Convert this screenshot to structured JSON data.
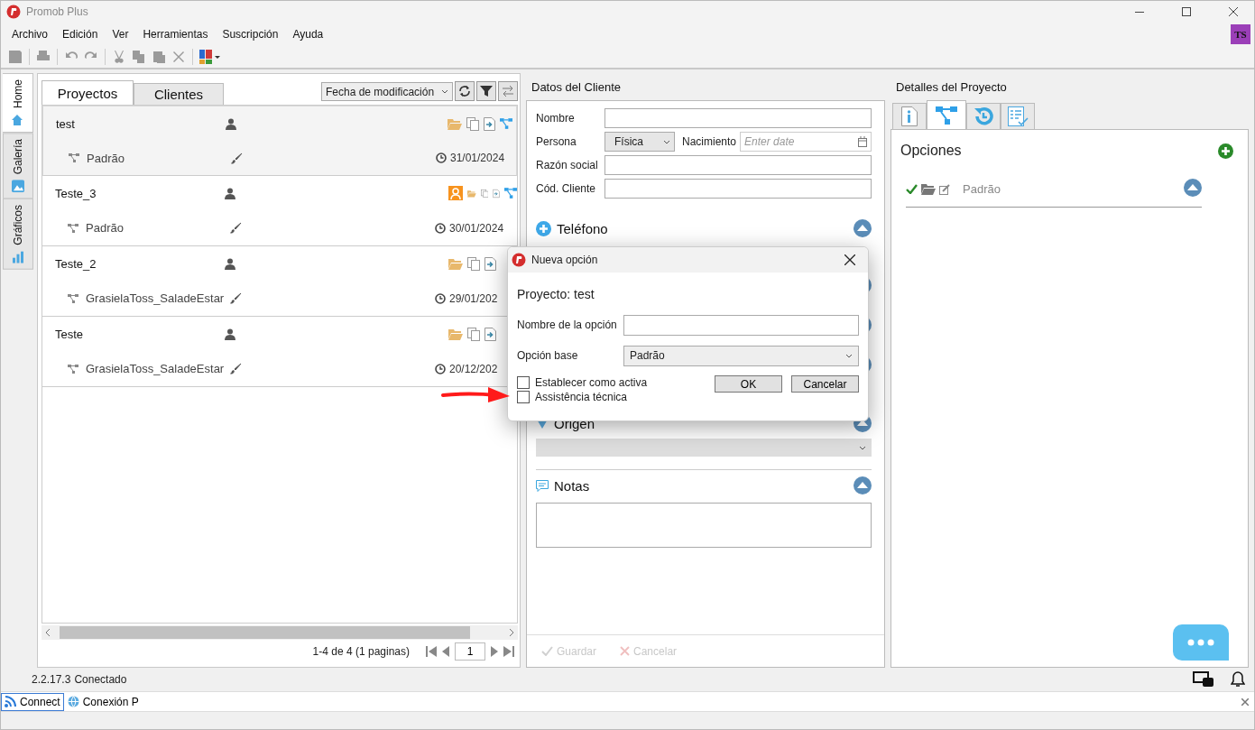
{
  "window": {
    "title": "Promob Plus"
  },
  "menu": [
    "Archivo",
    "Edición",
    "Ver",
    "Herramientas",
    "Suscripción",
    "Ayuda"
  ],
  "avatar": "TS",
  "side_tabs": [
    {
      "label": "Home",
      "selected": true,
      "kind": "home"
    },
    {
      "label": "Galería",
      "selected": false,
      "kind": "gallery"
    },
    {
      "label": "Gráficos",
      "selected": false,
      "kind": "charts"
    }
  ],
  "projects_panel": {
    "tabs": [
      {
        "label": "Proyectos",
        "selected": true
      },
      {
        "label": "Clientes",
        "selected": false
      }
    ],
    "sort": "Fecha de modificación",
    "projects": [
      {
        "name": "test",
        "selected": true,
        "shared": false,
        "branch_icon": true,
        "option": "Padrão",
        "date": "31/01/2024"
      },
      {
        "name": "Teste_3",
        "selected": false,
        "shared": true,
        "branch_icon": true,
        "option": "Padrão",
        "date": "30/01/2024"
      },
      {
        "name": "Teste_2",
        "selected": false,
        "shared": false,
        "branch_icon": false,
        "option": "GrasielaToss_SaladeEstar",
        "date": "29/01/202"
      },
      {
        "name": "Teste",
        "selected": false,
        "shared": false,
        "branch_icon": false,
        "option": "GrasielaToss_SaladeEstar",
        "date": "20/12/202"
      }
    ],
    "pager": {
      "summary": "1-4 de 4 (1 paginas)",
      "page": "1"
    }
  },
  "client_panel": {
    "title": "Datos del Cliente",
    "name_label": "Nombre",
    "person_label": "Persona",
    "person_value": "Física",
    "birth_label": "Nacimiento",
    "birth_placeholder": "Enter date",
    "company_label": "Razón social",
    "code_label": "Cód. Cliente",
    "phone_section": "Teléfono",
    "origin_section": "Origen",
    "notes_section": "Notas",
    "buttons": [
      {
        "label": "Guardar",
        "kind": "save",
        "disabled": true
      },
      {
        "label": "Cancelar",
        "kind": "cancel",
        "disabled": true
      }
    ]
  },
  "details_panel": {
    "title": "Detalles del Proyecto",
    "tabs": [
      {
        "kind": "info",
        "selected": false
      },
      {
        "kind": "options",
        "selected": true
      },
      {
        "kind": "history",
        "selected": false
      },
      {
        "kind": "checklist",
        "selected": false
      }
    ],
    "heading": "Opciones",
    "options": [
      {
        "name": "Padrão",
        "active": true
      }
    ]
  },
  "dialog": {
    "title": "Nueva opción",
    "project": "Proyecto: test",
    "name_label": "Nombre de la opción",
    "base_label": "Opción base",
    "base_value": "Padrão",
    "checkboxes": [
      {
        "label": "Establecer como activa",
        "checked": false
      },
      {
        "label": "Assistência técnica",
        "checked": false
      }
    ],
    "buttons": [
      "OK",
      "Cancelar"
    ]
  },
  "status_bar": {
    "version": "2.2.17.3",
    "state": "Conectado"
  },
  "bottom_tabs": [
    {
      "label": "Connect",
      "selected": true,
      "kind": "feed"
    },
    {
      "label": "Conexión P",
      "selected": false,
      "kind": "globe"
    }
  ]
}
